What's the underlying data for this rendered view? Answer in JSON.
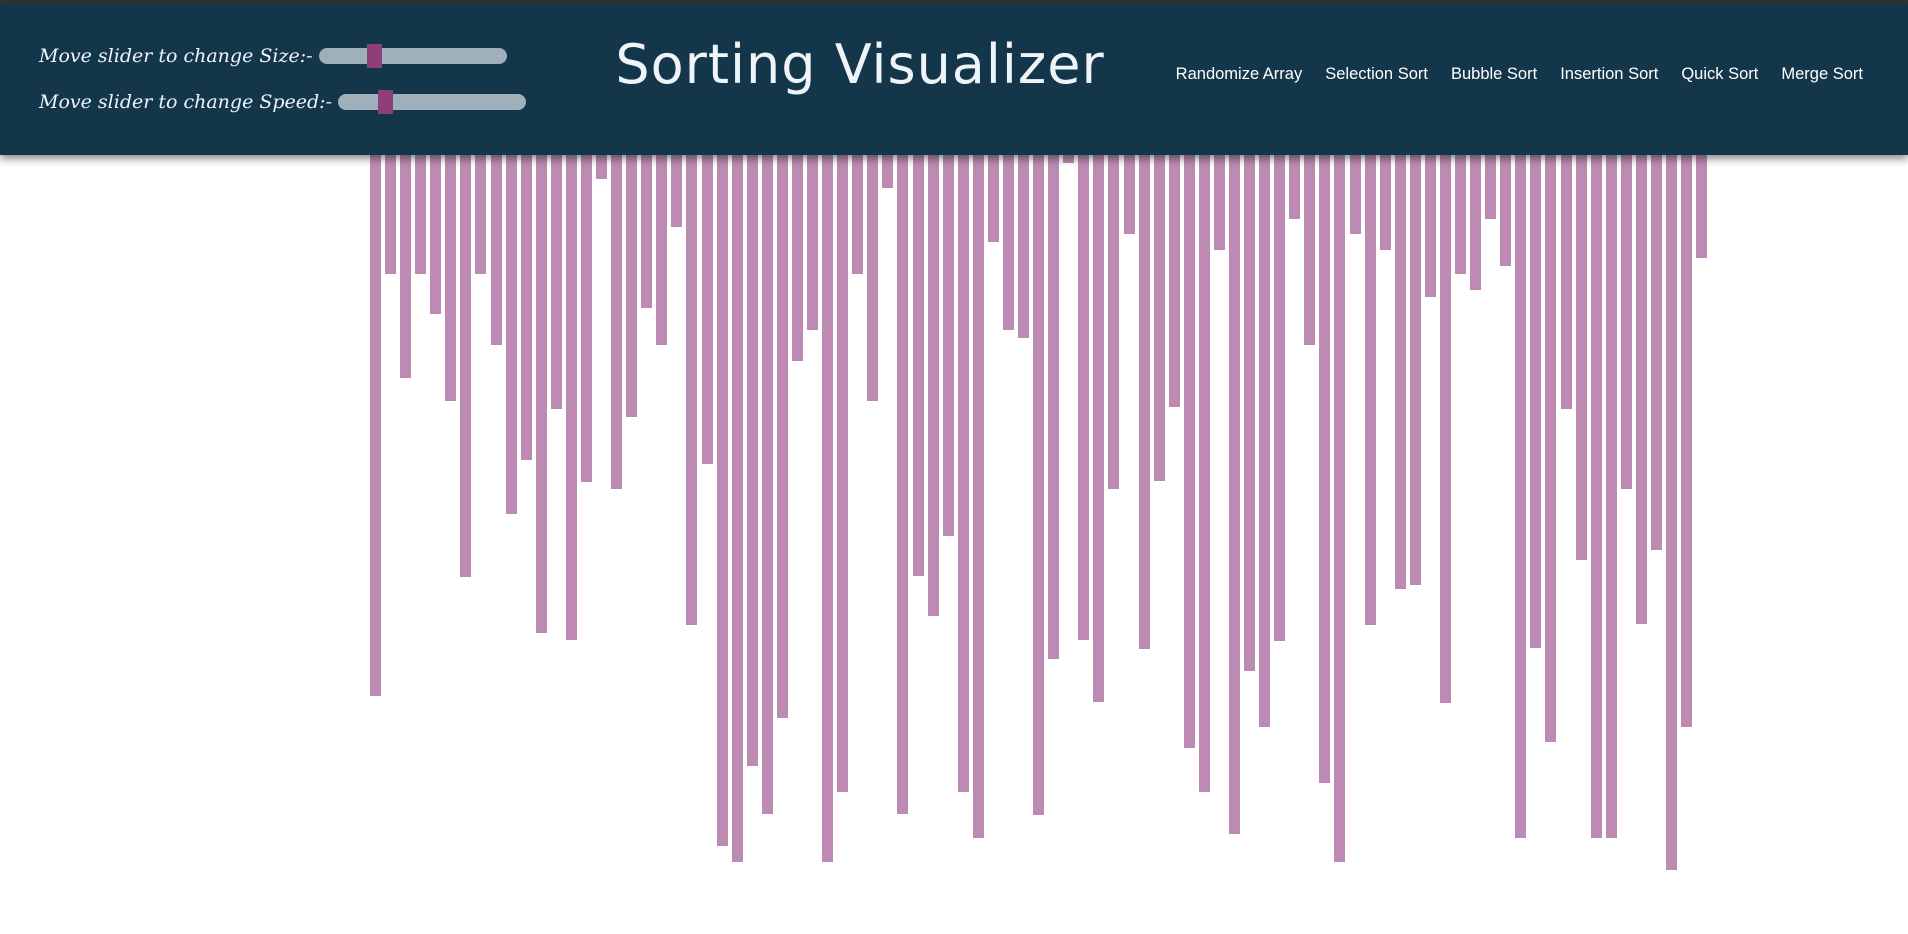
{
  "header": {
    "title": "Sorting Visualizer",
    "size_slider": {
      "label": "Move slider to change Size:-",
      "value": 0.28
    },
    "speed_slider": {
      "label": "Move slider to change Speed:-",
      "value": 0.23
    }
  },
  "nav": [
    "Randomize Array",
    "Selection Sort",
    "Bubble Sort",
    "Insertion Sort",
    "Quick Sort",
    "Merge Sort"
  ],
  "colors": {
    "header_bg": "#14364a",
    "bar": "#bd8ab3",
    "slider_thumb": "#8e3f78",
    "slider_track": "#9fb0ba"
  },
  "array": {
    "max_value": 725,
    "values": [
      545,
      120,
      225,
      120,
      160,
      248,
      425,
      120,
      191,
      361,
      307,
      481,
      256,
      488,
      329,
      24,
      336,
      264,
      154,
      191,
      73,
      473,
      311,
      696,
      712,
      615,
      664,
      567,
      207,
      176,
      712,
      641,
      120,
      248,
      33,
      664,
      424,
      464,
      384,
      641,
      688,
      88,
      176,
      184,
      665,
      508,
      8,
      488,
      551,
      336,
      80,
      497,
      328,
      254,
      597,
      641,
      96,
      684,
      520,
      576,
      489,
      64,
      191,
      632,
      712,
      80,
      473,
      96,
      437,
      433,
      143,
      552,
      120,
      136,
      64,
      112,
      688,
      496,
      591,
      256,
      408,
      688,
      688,
      336,
      472,
      398,
      720,
      576,
      104
    ]
  }
}
